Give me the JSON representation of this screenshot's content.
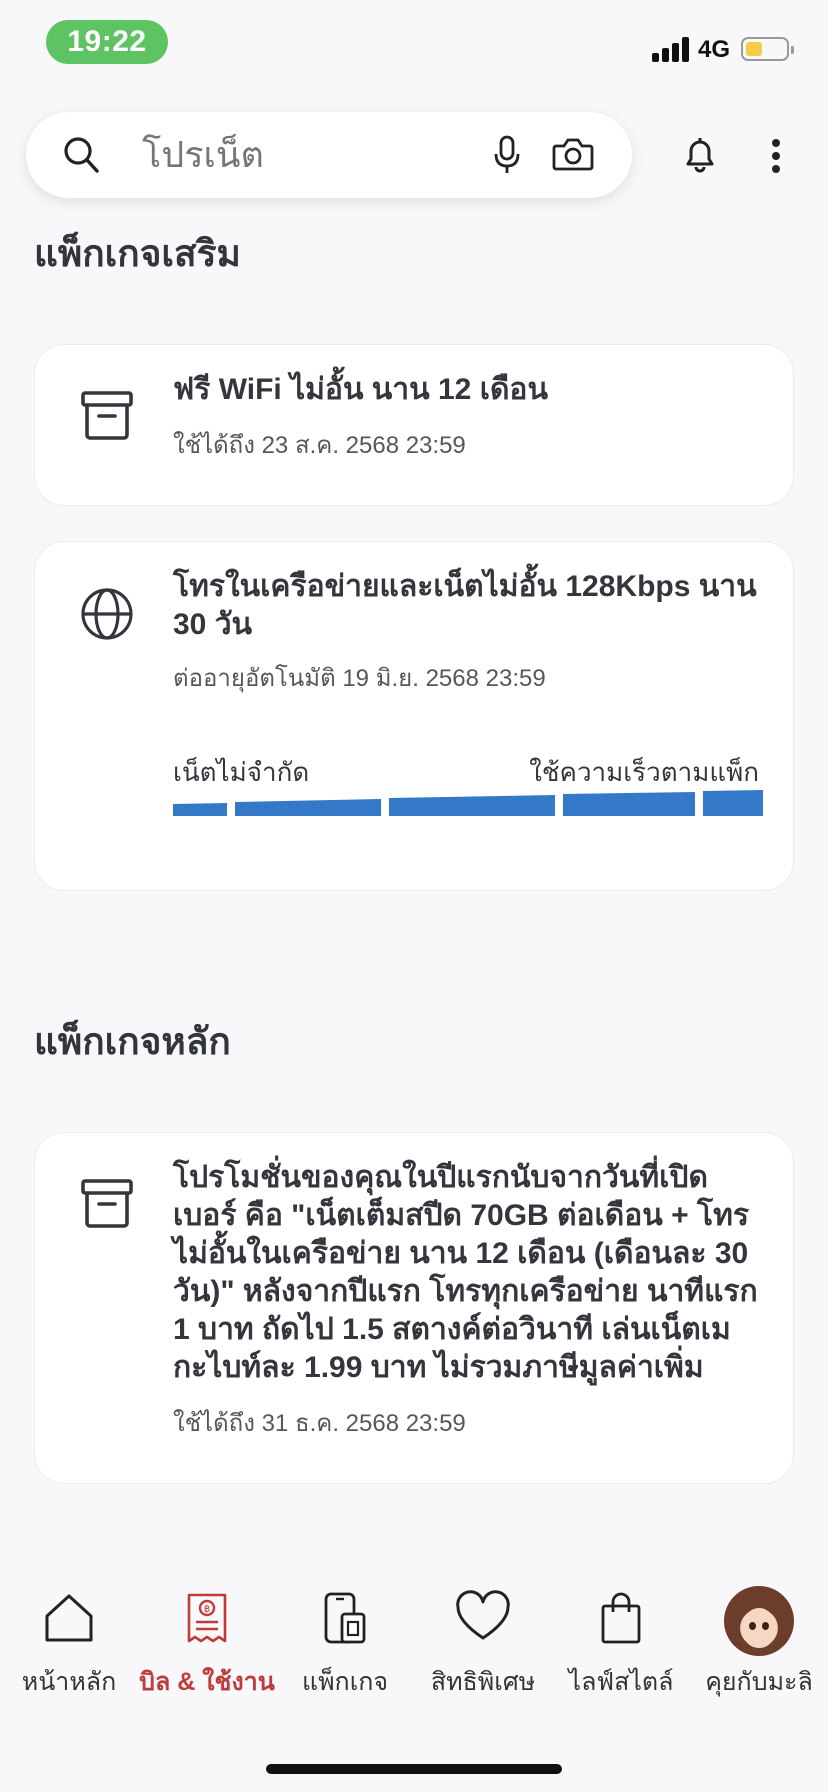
{
  "status_bar": {
    "time": "19:22",
    "network": "4G"
  },
  "search": {
    "placeholder": "โปรเน็ต"
  },
  "sections": {
    "addon_title": "แพ็กเกจเสริม",
    "main_title": "แพ็กเกจหลัก"
  },
  "addon_packages": [
    {
      "icon": "archive-box-icon",
      "title": "ฟรี WiFi ไม่อั้น นาน 12 เดือน",
      "subtitle": "ใช้ได้ถึง 23 ส.ค. 2568 23:59"
    },
    {
      "icon": "globe-icon",
      "title": "โทรในเครือข่ายและเน็ตไม่อั้น 128Kbps นาน 30 วัน",
      "subtitle": "ต่ออายุอัตโนมัติ 19 มิ.ย. 2568 23:59",
      "speed_left_label": "เน็ตไม่จำกัด",
      "speed_right_label": "ใช้ความเร็วตามแพ็ก"
    }
  ],
  "main_package": {
    "icon": "archive-box-icon",
    "title": "โปรโมชั่นของคุณในปีแรกนับจากวันที่เปิดเบอร์ คือ \"เน็ตเต็มสปีด 70GB ต่อเดือน + โทรไม่อั้นในเครือข่าย นาน 12 เดือน (เดือนละ 30 วัน)\" หลังจากปีแรก โทรทุกเครือข่าย นาทีแรก 1 บาท ถัดไป 1.5 สตางค์ต่อวินาที เล่นเน็ตเมกะไบท์ละ 1.99 บาท ไม่รวมภาษีมูลค่าเพิ่ม",
    "subtitle": "ใช้ได้ถึง 31 ธ.ค. 2568 23:59"
  },
  "bottom_nav": [
    {
      "label": "หน้าหลัก",
      "icon": "home-icon",
      "active": false
    },
    {
      "label": "บิล & ใช้งาน",
      "icon": "bill-icon",
      "active": true
    },
    {
      "label": "แพ็กเกจ",
      "icon": "phone-sim-icon",
      "active": false
    },
    {
      "label": "สิทธิพิเศษ",
      "icon": "heart-icon",
      "active": false
    },
    {
      "label": "ไลฟ์สไตล์",
      "icon": "shopping-bag-icon",
      "active": false
    },
    {
      "label": "คุยกับมะลิ",
      "icon": "assistant-avatar",
      "active": false
    }
  ],
  "colors": {
    "accent_red": "#c03b3b",
    "speed_bar_blue": "#3478c8",
    "time_pill_green": "#5ec463"
  }
}
